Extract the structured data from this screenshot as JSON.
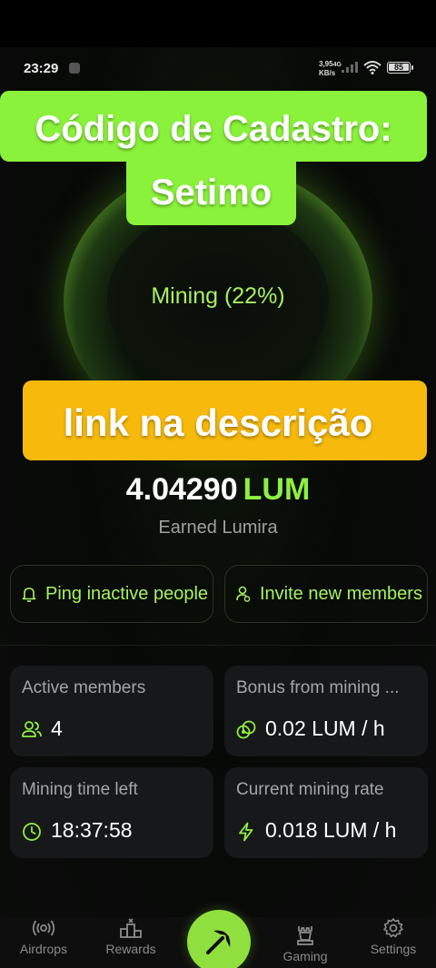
{
  "status_bar": {
    "time": "23:29",
    "network_speed": "3,95",
    "network_speed_unit": "KB/s",
    "network_type": "4G",
    "battery": "85"
  },
  "overlay": {
    "code_line1": "Código de Cadastro:",
    "code_line2": "Setimo",
    "link_text": "link na descrição"
  },
  "mining": {
    "status_label": "Mining (22%)",
    "progress_percent": 22
  },
  "earned": {
    "amount": "4.04290",
    "unit": "LUM",
    "label": "Earned Lumira"
  },
  "actions": {
    "ping_label": "Ping inactive people",
    "invite_label": "Invite new members"
  },
  "stats": {
    "active_members": {
      "title": "Active members",
      "value": "4"
    },
    "bonus": {
      "title": "Bonus from mining ...",
      "value": "0.02 LUM / h"
    },
    "time_left": {
      "title": "Mining time left",
      "value": "18:37:58"
    },
    "rate": {
      "title": "Current mining rate",
      "value": "0.018 LUM / h"
    }
  },
  "nav": {
    "airdrops": "Airdrops",
    "rewards": "Rewards",
    "gaming": "Gaming",
    "settings": "Settings"
  },
  "colors": {
    "accent_green": "#8af23a",
    "banner_yellow": "#f6b90c",
    "background": "#070907",
    "card": "#17181a"
  }
}
